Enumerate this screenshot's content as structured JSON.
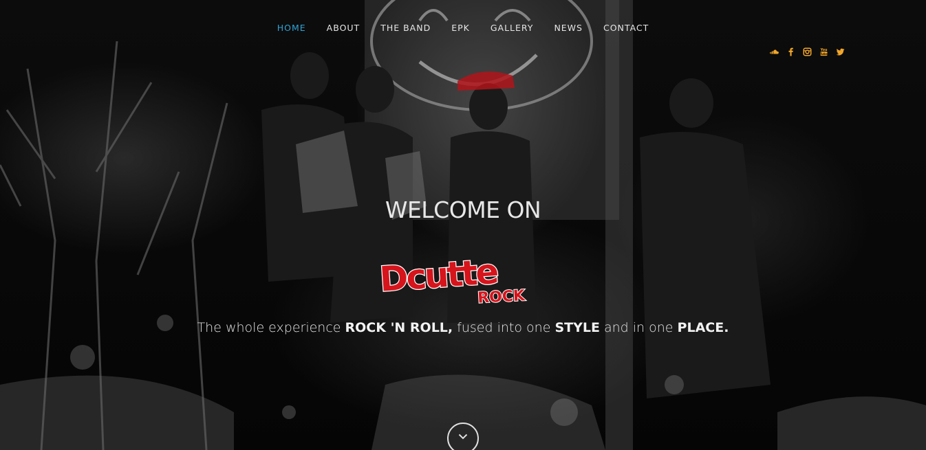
{
  "nav": {
    "items": [
      {
        "label": "HOME",
        "active": true
      },
      {
        "label": "ABOUT",
        "active": false
      },
      {
        "label": "THE BAND",
        "active": false
      },
      {
        "label": "EPK",
        "active": false
      },
      {
        "label": "GALLERY",
        "active": false
      },
      {
        "label": "NEWS",
        "active": false
      },
      {
        "label": "CONTACT",
        "active": false
      }
    ],
    "active_color": "#2fa4d6",
    "text_color": "#e6e6e6"
  },
  "social": {
    "color": "#f2a62a",
    "icons": [
      "soundcloud-icon",
      "facebook-icon",
      "instagram-icon",
      "youtube-icon",
      "twitter-icon"
    ]
  },
  "hero": {
    "welcome": "WELCOME ON",
    "logo": {
      "line1": "Dcutte",
      "line2": "ROCK",
      "color": "#d6141c"
    },
    "tagline": {
      "part1": "The whole experience ",
      "bold1": "ROCK 'N ROLL,",
      "part2": " fused into one ",
      "bold2": "STYLE",
      "part3": " and in one ",
      "bold3": "PLACE."
    },
    "scroll_icon": "chevron-down-icon"
  }
}
